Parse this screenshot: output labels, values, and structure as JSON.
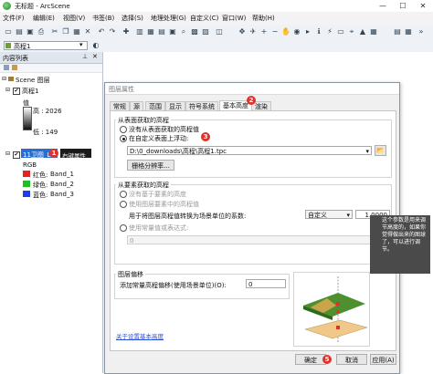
{
  "window": {
    "title": "无标题 - ArcScene",
    "minimize": "—",
    "maximize": "☐",
    "close": "✕"
  },
  "menu": [
    "文件(F)",
    "编辑(E)",
    "视图(V)",
    "书签(B)",
    "选择(S)",
    "地理处理(G)",
    "自定义(C)",
    "窗口(W)",
    "帮助(H)"
  ],
  "toolbar2": {
    "layer_select": "高程1"
  },
  "toc": {
    "title": "内容列表",
    "scene_label": "Scene 图层",
    "layer1": {
      "name": "高程1",
      "value_label": "值",
      "high": "高 : 2026",
      "low": "低 : 149"
    },
    "layer2": {
      "name": "11卫图_Le",
      "tag": "右键属性",
      "render": "RGB",
      "bands": [
        {
          "label": "红色:",
          "band": "Band_1",
          "color": "#e8231d"
        },
        {
          "label": "绿色:",
          "band": "Band_2",
          "color": "#1fbf2a"
        },
        {
          "label": "蓝色:",
          "band": "Band_3",
          "color": "#1d3ee8"
        }
      ]
    }
  },
  "dialog": {
    "title": "图层属性",
    "tabs": [
      "常规",
      "源",
      "范围",
      "显示",
      "符号系统",
      "基本高度",
      "渲染"
    ],
    "active_tab": "基本高度",
    "surface": {
      "legend": "从表面获取的高程",
      "opt_none": "没有从表面获取的高程值",
      "opt_custom": "在自定义表面上浮动:",
      "path": "D:\\0_downloads\\高程\\高程1.tpc",
      "raster_btn": "栅格分辨率..."
    },
    "feature": {
      "legend": "从要素获取的高程",
      "opt_none": "没有基于要素的高度",
      "opt_use": "使用图层要素中的高程值",
      "factor_label": "用于将图层高程值转换为场景单位的系数:",
      "unit": "自定义",
      "factor": "1.0000",
      "opt_const": "使用常量值或表达式:",
      "const_value": "0"
    },
    "offset": {
      "legend": "图层偏移",
      "label": "添加常量高程偏移(使用场景单位)(O):",
      "value": "0"
    },
    "link": "关于设置基本高度",
    "ok": "确定",
    "cancel": "取消",
    "apply": "应用(A)"
  },
  "badges": [
    "1",
    "2",
    "3",
    "4",
    "5"
  ],
  "tooltip": "这个参数是用来调节高度的，如果你觉得做出来的图球了，可以进行调节。"
}
